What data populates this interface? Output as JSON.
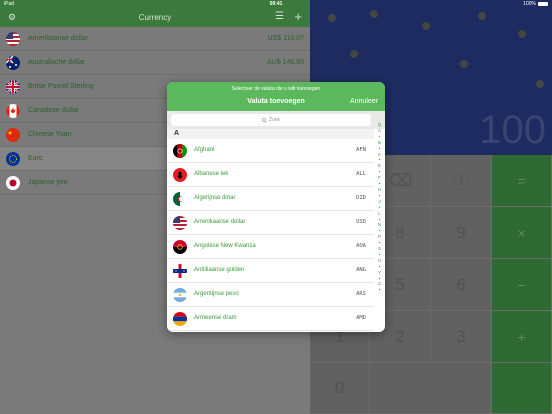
{
  "status": {
    "carrier": "iPad",
    "time": "09:41",
    "battery": "100%"
  },
  "left": {
    "title": "Currency",
    "rows": [
      {
        "name": "Amerikaanse dollar",
        "value": "US$ 110,07"
      },
      {
        "name": "Australische dollar",
        "value": "AU$ 146,83"
      },
      {
        "name": "Britse Pound Sterling",
        "value": ""
      },
      {
        "name": "Canadese dollar",
        "value": ""
      },
      {
        "name": "Chinese Yuan",
        "value": ""
      },
      {
        "name": "Euro",
        "value": ""
      },
      {
        "name": "Japanse yen",
        "value": ""
      }
    ]
  },
  "calculator": {
    "display": "100",
    "keys": {
      "del": "⌫",
      "info": "ⓘ",
      "eq": "=",
      "k9": "9",
      "k8": "8",
      "times": "×",
      "k6": "6",
      "k5": "5",
      "minus": "−",
      "k3": "3",
      "k2": "2",
      "k1": "1",
      "plus": "+",
      "k0": "0"
    }
  },
  "modal": {
    "subtitle": "Selecteer de valuta die u wilt toevoegen",
    "title": "Valuta toevoegen",
    "cancel": "Annuleer",
    "search_placeholder": "Zoek",
    "section": "A",
    "items": [
      {
        "name": "Afghani",
        "code": "AFN"
      },
      {
        "name": "Albanese lek",
        "code": "ALL"
      },
      {
        "name": "Algerijnse dinar",
        "code": "DZD"
      },
      {
        "name": "Amerikaanse dollar",
        "code": "USD"
      },
      {
        "name": "Angolese New Kwanza",
        "code": "AOA"
      },
      {
        "name": "Antilliaanse gulden",
        "code": "ANG"
      },
      {
        "name": "Argentijnse peso",
        "code": "ARS"
      },
      {
        "name": "Armeense dram",
        "code": "AMD"
      }
    ],
    "index": [
      "Q",
      "A",
      "•",
      "B",
      "•",
      "C",
      "•",
      "E",
      "•",
      "F",
      "•",
      "H",
      "•",
      "J",
      "•",
      "L",
      "•",
      "N",
      "•",
      "P",
      "•",
      "S",
      "•",
      "U",
      "•",
      "Y",
      "•",
      "Z",
      "•"
    ]
  }
}
